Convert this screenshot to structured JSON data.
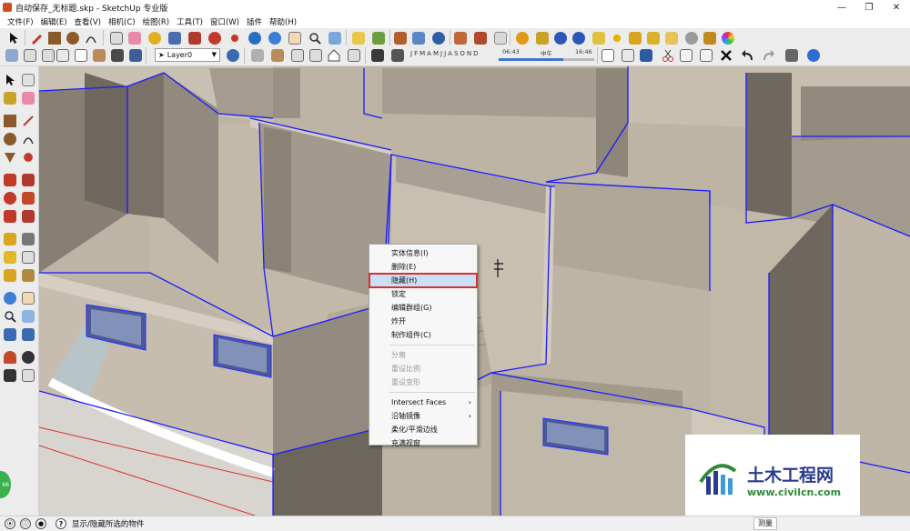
{
  "window": {
    "title": "自动保存_无标题.skp - SketchUp 专业版",
    "controls": {
      "minimize": "—",
      "maximize": "❐",
      "close": "✕"
    }
  },
  "menubar": {
    "items": [
      "文件(F)",
      "编辑(E)",
      "查看(V)",
      "相机(C)",
      "绘图(R)",
      "工具(T)",
      "窗口(W)",
      "插件",
      "帮助(H)"
    ]
  },
  "toolbar": {
    "layer_label": "Layer0",
    "months": [
      "J",
      "F",
      "M",
      "A",
      "M",
      "J",
      "J",
      "A",
      "S",
      "O",
      "N",
      "D"
    ],
    "shadow_time_start": "06:43",
    "shadow_time_mid": "中午",
    "shadow_time_end": "16:46",
    "shadow_time_fill_percent": 68
  },
  "context_menu": {
    "items": [
      {
        "label": "实体信息(I)",
        "enabled": true
      },
      {
        "label": "删除(E)",
        "enabled": true
      },
      {
        "label": "隐藏(H)",
        "enabled": true,
        "highlighted": true
      },
      {
        "label": "锁定",
        "enabled": true
      },
      {
        "label": "编辑群组(G)",
        "enabled": true
      },
      {
        "label": "炸开",
        "enabled": true
      },
      {
        "label": "制作组件(C)",
        "enabled": true
      },
      {
        "separator": true
      },
      {
        "label": "分离",
        "enabled": false
      },
      {
        "label": "重设比例",
        "enabled": false
      },
      {
        "label": "重设变形",
        "enabled": false
      },
      {
        "separator": true
      },
      {
        "label": "Intersect Faces",
        "enabled": true,
        "submenu": true
      },
      {
        "label": "沿轴镜像",
        "enabled": true,
        "submenu": true
      },
      {
        "label": "柔化/平滑边线",
        "enabled": true
      },
      {
        "label": "充满视窗",
        "enabled": true
      }
    ],
    "submenu_arrow": "›"
  },
  "statusbar": {
    "help_label": "?",
    "text": "显示/隐藏所选的物件",
    "measure_label": "测量"
  },
  "badge": {
    "text": "66"
  },
  "watermark": {
    "title": "土木工程网",
    "url": "www.civilcn.com"
  },
  "colors": {
    "selection_edge": "#1a1aff",
    "wall_face": "#c9c2b6",
    "floor": "#bcb3a4",
    "highlight_outline": "#d9302a",
    "highlight_fill": "#c9e0f7"
  }
}
